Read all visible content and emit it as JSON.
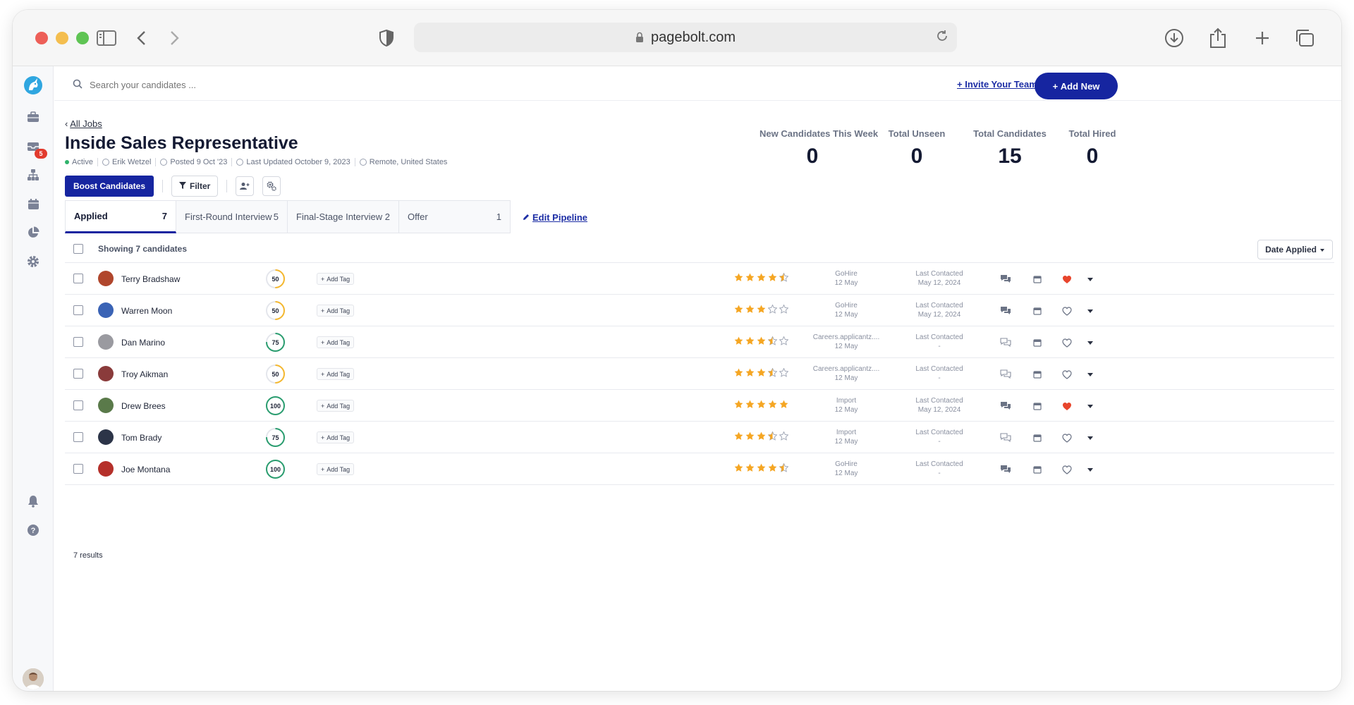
{
  "browser": {
    "url": "pagebolt.com"
  },
  "sidebar": {
    "items": [
      {
        "icon": "unicorn-logo-icon"
      },
      {
        "icon": "briefcase-icon"
      },
      {
        "icon": "inbox-icon",
        "badge": "5"
      },
      {
        "icon": "org-chart-icon"
      },
      {
        "icon": "calendar-icon"
      },
      {
        "icon": "pie-chart-icon"
      },
      {
        "icon": "gear-icon"
      }
    ],
    "bottom": [
      {
        "icon": "bell-icon"
      },
      {
        "icon": "help-icon"
      }
    ]
  },
  "topbar": {
    "search_placeholder": "Search your candidates ...",
    "invite_label": "Invite Your Team",
    "add_new_label": "Add New"
  },
  "job": {
    "back_label": "All Jobs",
    "title": "Inside Sales Representative",
    "status": "Active",
    "owner": "Erik Wetzel",
    "posted": "Posted 9 Oct '23",
    "updated": "Last Updated October 9, 2023",
    "location": "Remote, United States",
    "boost_label": "Boost Candidates",
    "filter_label": "Filter"
  },
  "stats": [
    {
      "label": "New Candidates This Week",
      "value": "0"
    },
    {
      "label": "Total Unseen",
      "value": "0"
    },
    {
      "label": "Total Candidates",
      "value": "15"
    },
    {
      "label": "Total Hired",
      "value": "0"
    }
  ],
  "pipeline": {
    "tabs": [
      {
        "label": "Applied",
        "count": "7"
      },
      {
        "label": "First-Round Interview",
        "count": "5"
      },
      {
        "label": "Final-Stage Interview",
        "count": "2"
      },
      {
        "label": "Offer",
        "count": "1"
      }
    ],
    "edit_label": "Edit Pipeline"
  },
  "list": {
    "showing": "Showing 7 candidates",
    "sort_label": "Date Applied",
    "results": "7 results",
    "candidates": [
      {
        "name": "Terry Bradshaw",
        "score": "50",
        "score_fraction": 0.5,
        "score_color": "#f5b82e",
        "tag_label": "Add Tag",
        "rating": 4.5,
        "source": "GoHire",
        "source_date": "12 May",
        "contact_label": "Last Contacted",
        "contact_date": "May 12, 2024",
        "messaged": true,
        "favorited": true,
        "avatar_color": "#b0462c"
      },
      {
        "name": "Warren Moon",
        "score": "50",
        "score_fraction": 0.5,
        "score_color": "#f5b82e",
        "tag_label": "Add Tag",
        "rating": 3,
        "source": "GoHire",
        "source_date": "12 May",
        "contact_label": "Last Contacted",
        "contact_date": "May 12, 2024",
        "messaged": true,
        "favorited": false,
        "avatar_color": "#3a63b5"
      },
      {
        "name": "Dan Marino",
        "score": "75",
        "score_fraction": 0.75,
        "score_color": "#2a9d6f",
        "tag_label": "Add Tag",
        "rating": 3.5,
        "source": "Careers.applicantz....",
        "source_date": "12 May",
        "contact_label": "Last Contacted",
        "contact_date": "-",
        "messaged": false,
        "favorited": false,
        "avatar_color": "#9a9aa0"
      },
      {
        "name": "Troy Aikman",
        "score": "50",
        "score_fraction": 0.5,
        "score_color": "#f5b82e",
        "tag_label": "Add Tag",
        "rating": 3.5,
        "source": "Careers.applicantz....",
        "source_date": "12 May",
        "contact_label": "Last Contacted",
        "contact_date": "-",
        "messaged": false,
        "favorited": false,
        "avatar_color": "#8a3b3b"
      },
      {
        "name": "Drew Brees",
        "score": "100",
        "score_fraction": 1,
        "score_color": "#2a9d6f",
        "tag_label": "Add Tag",
        "rating": 5,
        "source": "Import",
        "source_date": "12 May",
        "contact_label": "Last Contacted",
        "contact_date": "May 12, 2024",
        "messaged": true,
        "favorited": true,
        "avatar_color": "#5a7a4a"
      },
      {
        "name": "Tom Brady",
        "score": "75",
        "score_fraction": 0.75,
        "score_color": "#2a9d6f",
        "tag_label": "Add Tag",
        "rating": 3.5,
        "source": "Import",
        "source_date": "12 May",
        "contact_label": "Last Contacted",
        "contact_date": "-",
        "messaged": false,
        "favorited": false,
        "avatar_color": "#2c3448"
      },
      {
        "name": "Joe Montana",
        "score": "100",
        "score_fraction": 1,
        "score_color": "#2a9d6f",
        "tag_label": "Add Tag",
        "rating": 4.5,
        "source": "GoHire",
        "source_date": "12 May",
        "contact_label": "Last Contacted",
        "contact_date": "-",
        "messaged": true,
        "favorited": false,
        "avatar_color": "#b5302a"
      }
    ]
  },
  "colors": {
    "brand": "#1625a0",
    "star": "#f5a623",
    "heart": "#e8452c"
  }
}
